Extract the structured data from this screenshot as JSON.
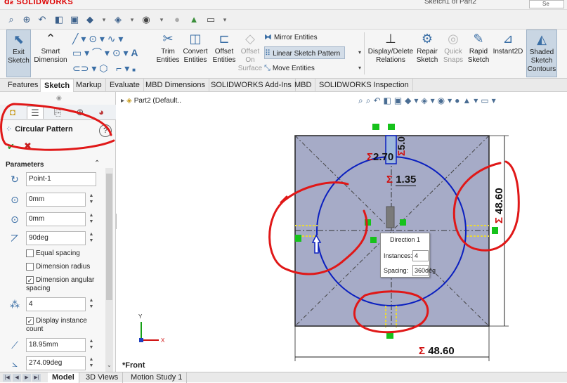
{
  "app": {
    "logo": "SOLIDWORKS",
    "document_title": "Sketch1 of Part2",
    "help_search": "Se"
  },
  "icons": [
    "zoom-icon",
    "zoom-area-icon",
    "previous-view-icon",
    "section-view-icon",
    "view-orientation-icon",
    "display-style-icon",
    "hide-show-icon",
    "appearance-icon",
    "scene-icon",
    "view-settings-icon"
  ],
  "command_manager": {
    "exit_sketch": "Exit\nSketch",
    "smart_dimension": "Smart\nDimension",
    "trim_entities": "Trim\nEntities",
    "convert_entities": "Convert\nEntities",
    "offset_entities": "Offset\nEntities",
    "offset_on_surface": "Offset\nOn\nSurface",
    "mirror_entities": "Mirror Entities",
    "linear_sketch_pattern": "Linear Sketch Pattern",
    "move_entities": "Move Entities",
    "display_delete_relations": "Display/Delete\nRelations",
    "repair_sketch": "Repair\nSketch",
    "quick_snaps": "Quick\nSnaps",
    "rapid_sketch": "Rapid\nSketch",
    "instant2d": "Instant2D",
    "shaded_sketch_contours": "Shaded\nSketch\nContours"
  },
  "tabs": [
    "Features",
    "Sketch",
    "Markup",
    "Evaluate",
    "MBD Dimensions",
    "SOLIDWORKS Add-Ins",
    "MBD",
    "SOLIDWORKS Inspection"
  ],
  "active_tab": "Sketch",
  "property_manager": {
    "title": "Circular Pattern",
    "ok": "✔",
    "cancel": "✖",
    "parameters_header": "Parameters",
    "center_point": "Point-1",
    "center_x": "0mm",
    "center_y": "0mm",
    "angle": "90deg",
    "equal_spacing": "Equal spacing",
    "dimension_radius": "Dimension radius",
    "dimension_angular_spacing": "Dimension angular spacing",
    "instances": "4",
    "display_instance_count": "Display instance count",
    "radius": "18.95mm",
    "arc_angle": "274.09deg"
  },
  "graphics": {
    "tree_item": "Part2  (Default..",
    "view_label": "*Front",
    "direction_popup": {
      "title": "Direction 1",
      "instances_label": "Instances:",
      "instances_value": "4",
      "spacing_label": "Spacing:",
      "spacing_value": "360deg"
    },
    "dimensions": {
      "top_left": "2.70",
      "top_right": "5.0",
      "slot_width": "1.35",
      "height": "48.60",
      "width": "48.60",
      "sigma": "Σ"
    }
  },
  "bottom_tabs": [
    "Model",
    "3D Views",
    "Motion Study 1"
  ],
  "active_bottom_tab": "Model",
  "colors": {
    "sketch_blue": "#0a1fbf",
    "annotation_red": "#e01818",
    "plane_fill": "#a6abc7",
    "constraint_green": "#16c21b",
    "dimension_red": "#d01010"
  }
}
